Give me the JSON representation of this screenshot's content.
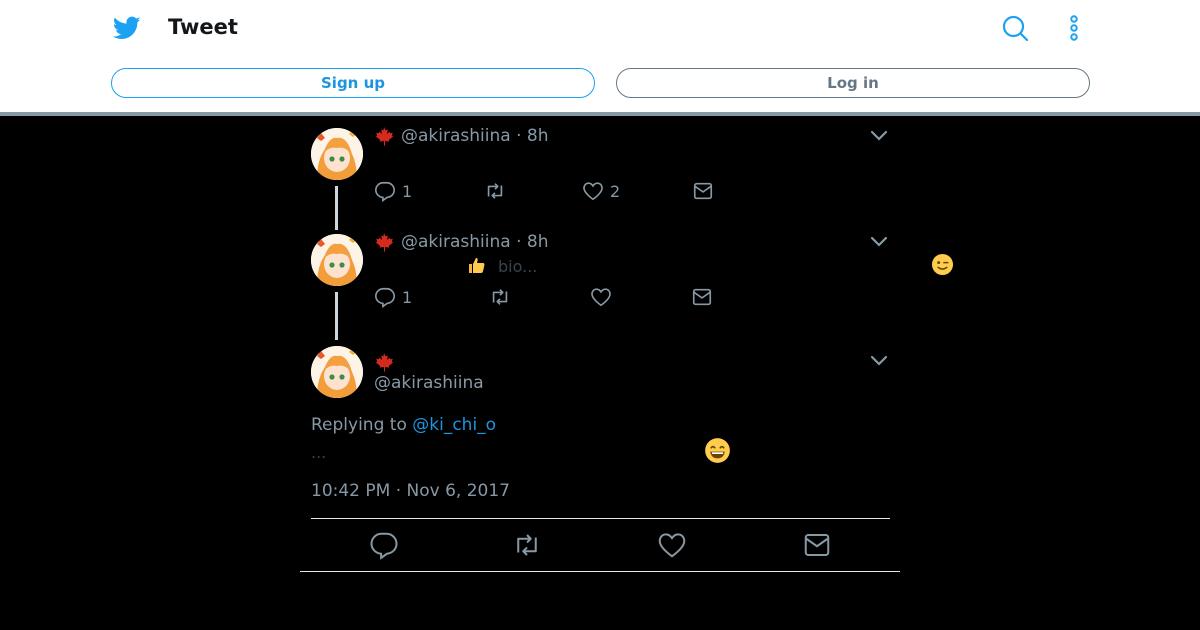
{
  "header": {
    "title": "Tweet",
    "signup_label": "Sign up",
    "login_label": "Log in",
    "brand_color": "#1da1f2"
  },
  "tweets": [
    {
      "handle": "@akirashiina · 8h",
      "flag_icon": "maple-leaf",
      "reply_count": "1",
      "like_count": "2"
    },
    {
      "handle": "@akirashiina · 8h",
      "flag_icon": "maple-leaf",
      "text": "bio...",
      "reply_count": "1",
      "like_count": ""
    }
  ],
  "main_tweet": {
    "flag_icon": "maple-leaf",
    "handle": "@akirashiina",
    "replying_prefix": "Replying to",
    "replying_to": "@ki_chi_o",
    "body_text": "...",
    "timestamp": "10:42 PM · Nov 6, 2017"
  },
  "icons": [
    "twitter-bird",
    "search",
    "more-vertical",
    "chevron-down",
    "reply",
    "retweet",
    "like",
    "direct-message",
    "thumbs-up-emoji",
    "winking-emoji",
    "grinning-emoji"
  ]
}
